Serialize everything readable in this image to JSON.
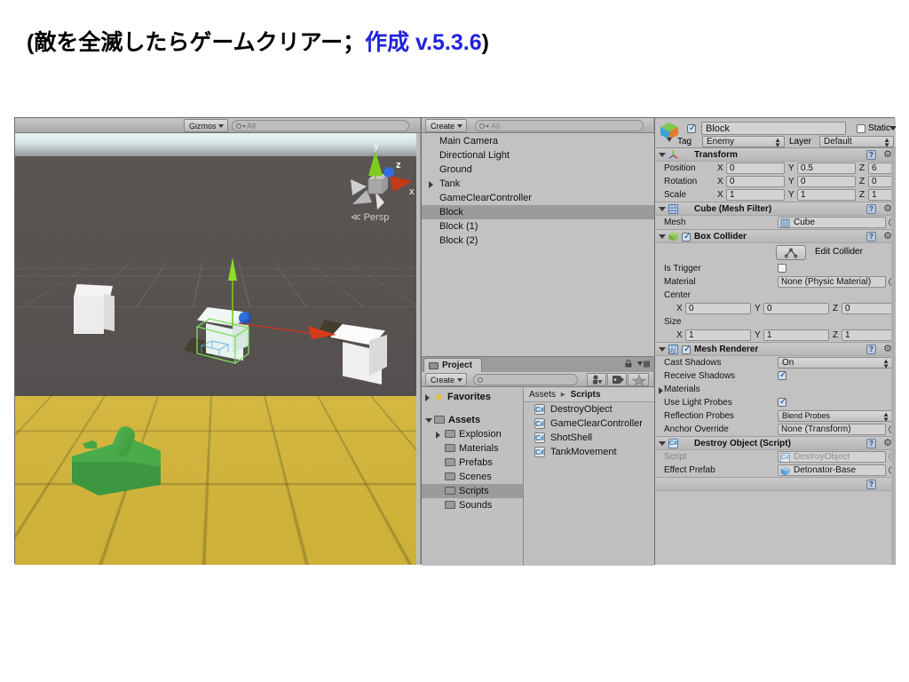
{
  "slide": {
    "title_prefix": "(敵を全滅したらゲームクリアー；",
    "title_highlight": "作成 v.5.3.6",
    "title_suffix": ")",
    "highlight_color": "#2222dd"
  },
  "scene": {
    "toolbar": {
      "gizmos_label": "Gizmos",
      "search_placeholder": "All"
    },
    "gizmo": {
      "axis_y": "y",
      "axis_z": "z",
      "axis_x": "x",
      "projection_label": "Persp",
      "color_x": "#c23a18",
      "color_y": "#7fcc20",
      "color_z": "#2f6fe0"
    },
    "colors": {
      "ground": "#cfb02d",
      "backdrop": "#565150",
      "tank": "#3f9a3f",
      "block": "#efefef"
    }
  },
  "hierarchy": {
    "create_label": "Create",
    "search_placeholder": "All",
    "items": [
      {
        "label": "Main Camera",
        "expandable": false,
        "selected": false,
        "indent": 0
      },
      {
        "label": "Directional Light",
        "expandable": false,
        "selected": false,
        "indent": 0
      },
      {
        "label": "Ground",
        "expandable": false,
        "selected": false,
        "indent": 0
      },
      {
        "label": "Tank",
        "expandable": true,
        "selected": false,
        "indent": 0
      },
      {
        "label": "GameClearController",
        "expandable": false,
        "selected": false,
        "indent": 0
      },
      {
        "label": "Block",
        "expandable": false,
        "selected": true,
        "indent": 0
      },
      {
        "label": "Block (1)",
        "expandable": false,
        "selected": false,
        "indent": 0
      },
      {
        "label": "Block (2)",
        "expandable": false,
        "selected": false,
        "indent": 0
      }
    ]
  },
  "project": {
    "tab_label": "Project",
    "create_label": "Create",
    "search_placeholder": "",
    "breadcrumb": {
      "root": "Assets",
      "separator": "▸",
      "current": "Scripts"
    },
    "tree": [
      {
        "label": "Favorites",
        "type": "favorites",
        "expandable": true,
        "expanded": false,
        "selected": false,
        "indent": 0
      },
      {
        "label": "Assets",
        "type": "folder",
        "expandable": true,
        "expanded": true,
        "selected": false,
        "indent": 0
      },
      {
        "label": "Explosion",
        "type": "folder",
        "expandable": true,
        "expanded": false,
        "selected": false,
        "indent": 1
      },
      {
        "label": "Materials",
        "type": "folder",
        "expandable": false,
        "expanded": false,
        "selected": false,
        "indent": 1
      },
      {
        "label": "Prefabs",
        "type": "folder",
        "expandable": false,
        "expanded": false,
        "selected": false,
        "indent": 1
      },
      {
        "label": "Scenes",
        "type": "folder",
        "expandable": false,
        "expanded": false,
        "selected": false,
        "indent": 1
      },
      {
        "label": "Scripts",
        "type": "folder",
        "expandable": false,
        "expanded": false,
        "selected": true,
        "indent": 1
      },
      {
        "label": "Sounds",
        "type": "folder",
        "expandable": false,
        "expanded": false,
        "selected": false,
        "indent": 1
      }
    ],
    "assets": [
      {
        "label": "DestroyObject",
        "icon": "csharp-script-icon"
      },
      {
        "label": "GameClearController",
        "icon": "csharp-script-icon"
      },
      {
        "label": "ShotShell",
        "icon": "csharp-script-icon"
      },
      {
        "label": "TankMovement",
        "icon": "csharp-script-icon"
      }
    ]
  },
  "inspector": {
    "object": {
      "enabled": true,
      "name": "Block",
      "static_label": "Static",
      "static_checked": false,
      "tag_label": "Tag",
      "tag_value": "Enemy",
      "layer_label": "Layer",
      "layer_value": "Default"
    },
    "components": [
      {
        "title": "Transform",
        "icon": "transform-axis-icon",
        "rows": [
          {
            "label": "Position",
            "x": "0",
            "y": "0.5",
            "z": "6"
          },
          {
            "label": "Rotation",
            "x": "0",
            "y": "0",
            "z": "0"
          },
          {
            "label": "Scale",
            "x": "1",
            "y": "1",
            "z": "1"
          }
        ]
      },
      {
        "title": "Cube (Mesh Filter)",
        "icon": "mesh-filter-icon",
        "mesh_label": "Mesh",
        "mesh_value": "Cube"
      },
      {
        "title": "Box Collider",
        "icon": "box-collider-icon",
        "enabled": true,
        "edit_collider_label": "Edit Collider",
        "is_trigger_label": "Is Trigger",
        "is_trigger_checked": false,
        "material_label": "Material",
        "material_value": "None (Physic Material)",
        "center_label": "Center",
        "center": {
          "x": "0",
          "y": "0",
          "z": "0"
        },
        "size_label": "Size",
        "size": {
          "x": "1",
          "y": "1",
          "z": "1"
        }
      },
      {
        "title": "Mesh Renderer",
        "icon": "mesh-renderer-icon",
        "enabled": true,
        "cast_shadows_label": "Cast Shadows",
        "cast_shadows_value": "On",
        "receive_shadows_label": "Receive Shadows",
        "receive_shadows_checked": true,
        "materials_label": "Materials",
        "use_light_probes_label": "Use Light Probes",
        "use_light_probes_checked": true,
        "reflection_probes_label": "Reflection Probes",
        "reflection_probes_value": "Blend Probes",
        "anchor_override_label": "Anchor Override",
        "anchor_override_value": "None (Transform)"
      },
      {
        "title": "Destroy Object (Script)",
        "icon": "csharp-script-icon",
        "script_label": "Script",
        "script_value": "DestroyObject",
        "effect_prefab_label": "Effect Prefab",
        "effect_prefab_value": "Detonator-Base"
      }
    ],
    "axis_labels": {
      "x": "X",
      "y": "Y",
      "z": "Z"
    }
  }
}
